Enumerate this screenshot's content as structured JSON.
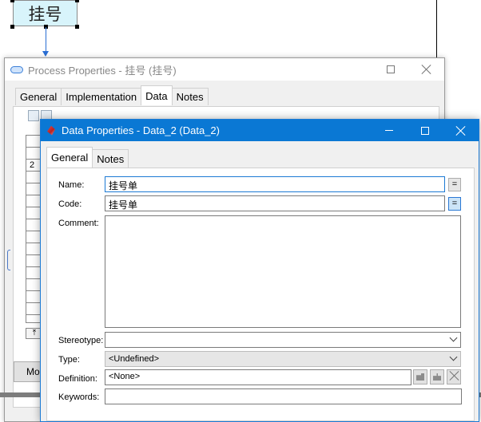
{
  "diagram": {
    "process_node_label": "挂号"
  },
  "process_window": {
    "title": "Process Properties - 挂号 (挂号)",
    "tabs": [
      "General",
      "Implementation",
      "Data",
      "Notes"
    ],
    "active_tab": "Data",
    "grid_row_number": "2",
    "footer_button_label": "Mor"
  },
  "data_window": {
    "title": "Data Properties - Data_2 (Data_2)",
    "tabs": [
      "General",
      "Notes"
    ],
    "active_tab": "General",
    "fields": {
      "name_label": "Name:",
      "name_value": "挂号单",
      "code_label": "Code:",
      "code_value": "挂号单",
      "comment_label": "Comment:",
      "comment_value": "",
      "stereotype_label": "Stereotype:",
      "stereotype_value": "",
      "type_label": "Type:",
      "type_value": "<Undefined>",
      "definition_label": "Definition:",
      "definition_value": "<None>",
      "keywords_label": "Keywords:",
      "keywords_value": "",
      "equals_glyph": "="
    }
  },
  "colors": {
    "titlebar_active": "#0a78d4",
    "node_fill": "#d8f4fb",
    "link": "#2a6ed4"
  }
}
